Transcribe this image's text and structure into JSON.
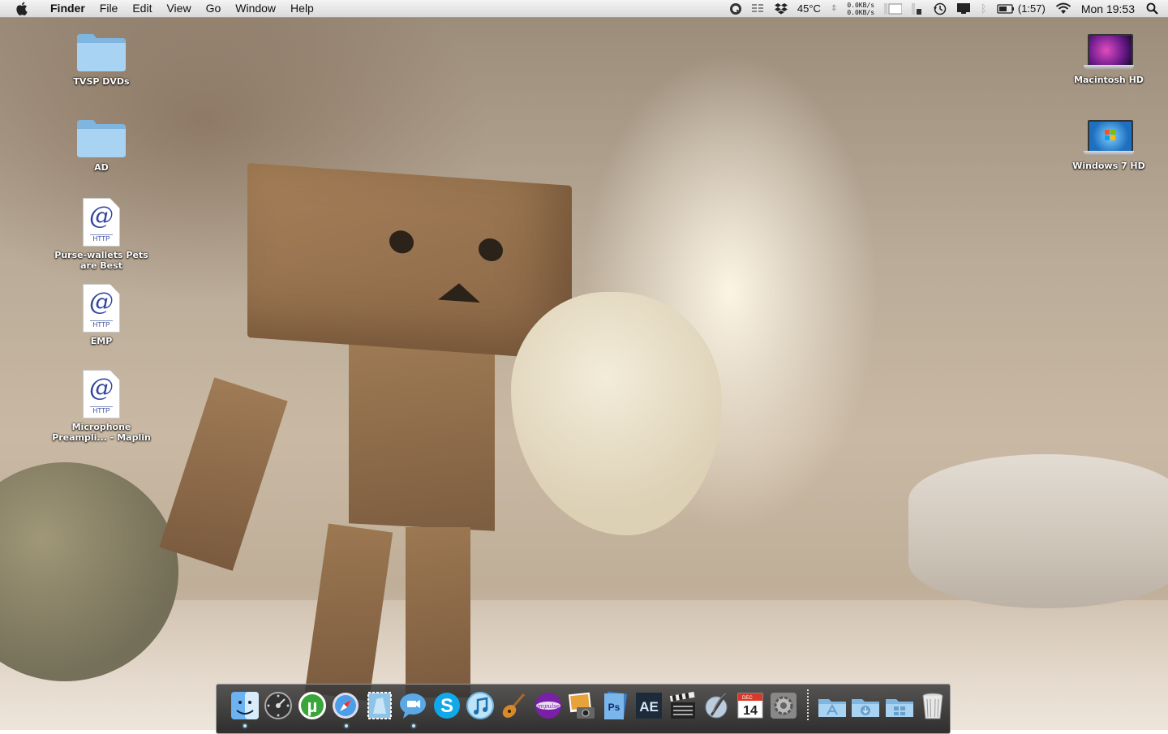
{
  "menubar": {
    "app_name": "Finder",
    "menus": [
      "File",
      "Edit",
      "View",
      "Go",
      "Window",
      "Help"
    ],
    "status": {
      "temperature": "45°C",
      "net_up": "0.0KB/s",
      "net_down": "0.0KB/s",
      "battery_time": "(1:57)",
      "clock": "Mon 19:53"
    }
  },
  "desktop_icons_left": [
    {
      "label": "TVSP DVDs",
      "kind": "folder"
    },
    {
      "label": "AD",
      "kind": "folder"
    },
    {
      "label": "Purse-wallets Pets are Best",
      "kind": "http",
      "badge": "HTTP"
    },
    {
      "label": "EMP",
      "kind": "http",
      "badge": "HTTP"
    },
    {
      "label": "Microphone Preampli... - Maplin",
      "kind": "http",
      "badge": "HTTP"
    }
  ],
  "desktop_icons_right": [
    {
      "label": "Macintosh HD",
      "kind": "drive-mac"
    },
    {
      "label": "Windows 7 HD",
      "kind": "drive-win"
    }
  ],
  "dock": {
    "calendar_month": "DEC",
    "calendar_day": "14",
    "ae_label": "AE",
    "items": [
      {
        "name": "finder",
        "running": true
      },
      {
        "name": "dashboard",
        "running": false
      },
      {
        "name": "utorrent",
        "running": false
      },
      {
        "name": "safari",
        "running": true
      },
      {
        "name": "mail",
        "running": false
      },
      {
        "name": "ichat",
        "running": true
      },
      {
        "name": "skype",
        "running": false
      },
      {
        "name": "itunes",
        "running": false
      },
      {
        "name": "garageband",
        "running": false
      },
      {
        "name": "impulse",
        "running": false
      },
      {
        "name": "iphoto",
        "running": false
      },
      {
        "name": "photoshop",
        "running": false
      },
      {
        "name": "after-effects",
        "running": false
      },
      {
        "name": "final-cut",
        "running": false
      },
      {
        "name": "script-editor",
        "running": false
      },
      {
        "name": "ical",
        "running": false
      },
      {
        "name": "system-preferences",
        "running": false
      }
    ]
  },
  "colors": {
    "menubar_top": "#f4f4f4",
    "menubar_bottom": "#dadada",
    "folder_blue": "#8ec4ea",
    "http_blue": "#3246a0"
  }
}
